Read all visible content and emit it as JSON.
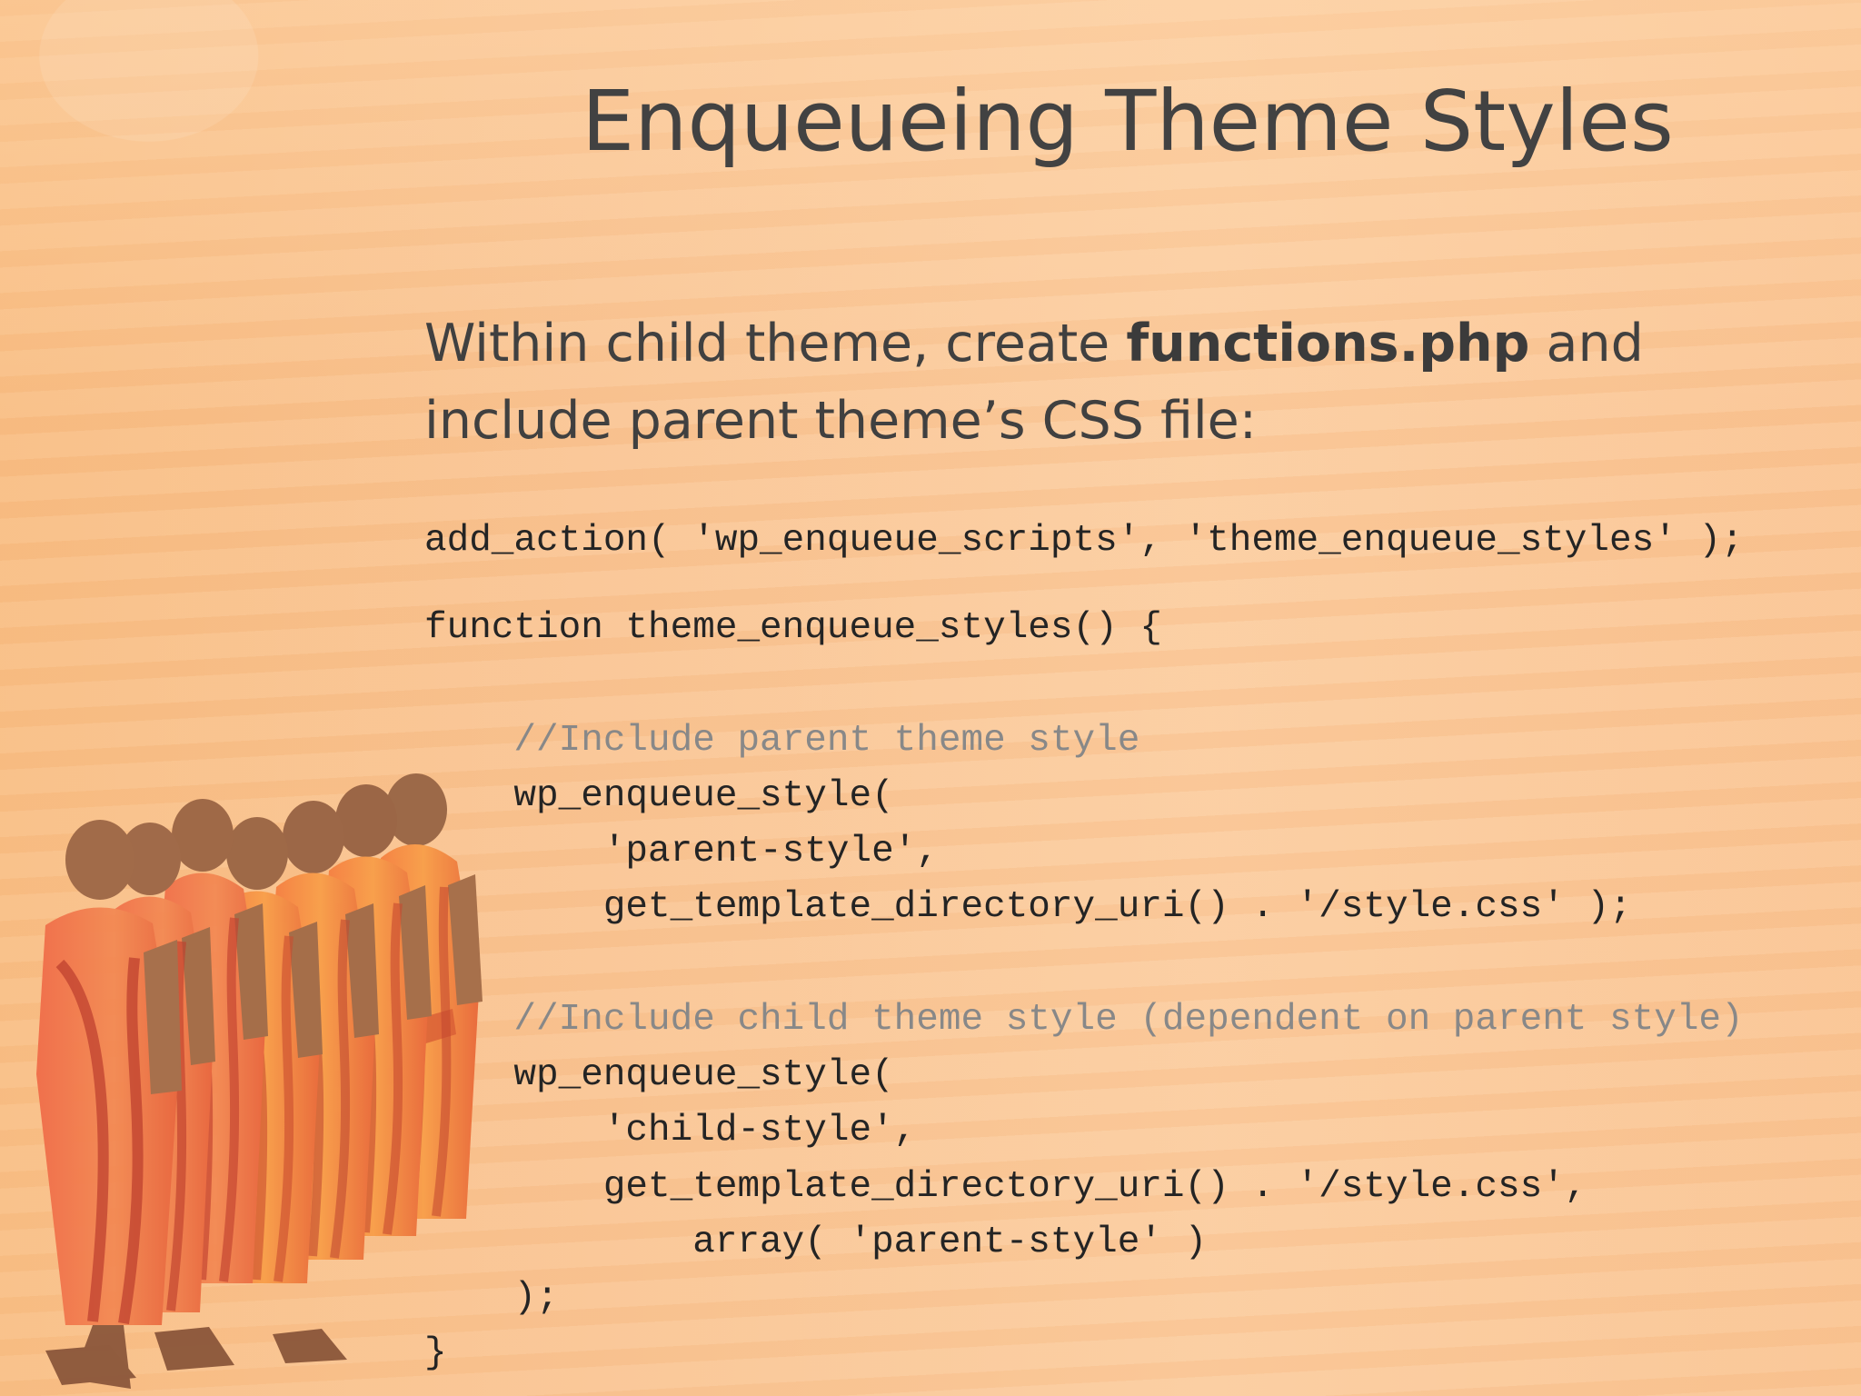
{
  "slide": {
    "title": "Enqueueing Theme Styles",
    "intro": {
      "before": "Within child theme, create ",
      "bold": "functions.php",
      "after": " and include parent theme’s CSS file:"
    },
    "code": {
      "line1": "add_action( 'wp_enqueue_scripts', 'theme_enqueue_styles' );",
      "line2": "function theme_enqueue_styles() {",
      "comment1": "    //Include parent theme style",
      "line4": "    wp_enqueue_style(",
      "line5": "        'parent-style',",
      "line6": "        get_template_directory_uri() . '/style.css' );",
      "comment2": "    //Include child theme style (dependent on parent style)",
      "line8": "    wp_enqueue_style(",
      "line9": "        'child-style',",
      "line10": "        get_template_directory_uri() . '/style.css',",
      "line11": "            array( 'parent-style' )",
      "line12": "    );",
      "line13": "}"
    },
    "colors": {
      "background": "#f8c596",
      "text": "#404040",
      "code": "#242424",
      "comment": "#888888",
      "robe": "#ef7d4f"
    }
  }
}
